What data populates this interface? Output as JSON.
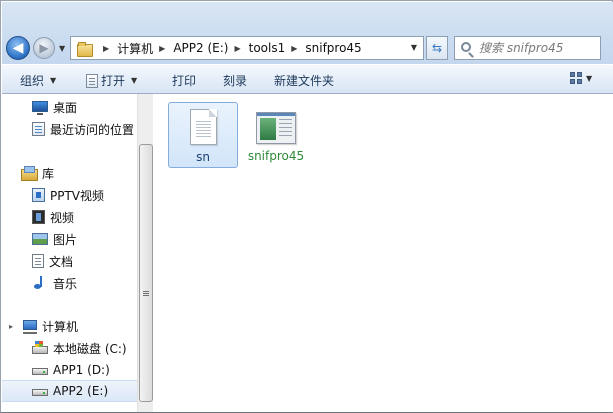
{
  "address_bar": {
    "breadcrumb": [
      "计算机",
      "APP2 (E:)",
      "tools1",
      "snifpro45"
    ],
    "search_placeholder": "搜索 snifpro45"
  },
  "command_bar": {
    "organize": "组织",
    "open": "打开",
    "print": "打印",
    "burn": "刻录",
    "new_folder": "新建文件夹"
  },
  "nav_pane": {
    "favorites": {
      "desktop": "桌面",
      "recent": "最近访问的位置"
    },
    "libraries": {
      "header": "库",
      "pptv": "PPTV视频",
      "video": "视频",
      "pictures": "图片",
      "documents": "文档",
      "music": "音乐"
    },
    "computer": {
      "header": "计算机",
      "drive_c": "本地磁盘 (C:)",
      "drive_d": "APP1 (D:)",
      "drive_e": "APP2 (E:)"
    }
  },
  "files": [
    {
      "name": "sn",
      "type": "text-document",
      "selected": true
    },
    {
      "name": "snifpro45",
      "type": "application",
      "selected": false
    }
  ],
  "colors": {
    "accent": "#3a78c0",
    "app_label": "#2e8b3a",
    "selection": "#d2e5fa"
  }
}
